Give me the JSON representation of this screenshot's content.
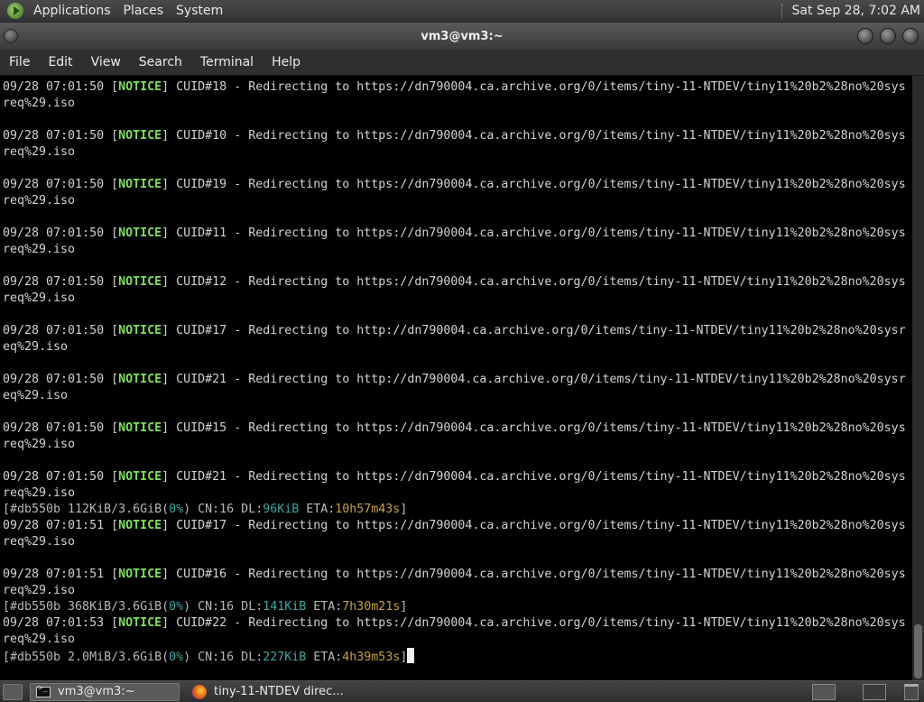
{
  "top_panel": {
    "menus": [
      "Applications",
      "Places",
      "System"
    ],
    "clock": "Sat Sep 28, 7:02 AM"
  },
  "window": {
    "title": "vm3@vm3:~"
  },
  "menubar": [
    "File",
    "Edit",
    "View",
    "Search",
    "Terminal",
    "Help"
  ],
  "terminal": {
    "lines": [
      [
        {
          "t": "09/28 07:01:50 [",
          "c": ""
        },
        {
          "t": "NOTICE",
          "c": "notice"
        },
        {
          "t": "] CUID#18 - Redirecting to https://dn790004.ca.archive.org/0/items/tiny-11-NTDEV/tiny11%20b2%28no%20sys",
          "c": ""
        }
      ],
      [
        {
          "t": "req%29.iso",
          "c": ""
        }
      ],
      [],
      [
        {
          "t": "09/28 07:01:50 [",
          "c": ""
        },
        {
          "t": "NOTICE",
          "c": "notice"
        },
        {
          "t": "] CUID#10 - Redirecting to https://dn790004.ca.archive.org/0/items/tiny-11-NTDEV/tiny11%20b2%28no%20sys",
          "c": ""
        }
      ],
      [
        {
          "t": "req%29.iso",
          "c": ""
        }
      ],
      [],
      [
        {
          "t": "09/28 07:01:50 [",
          "c": ""
        },
        {
          "t": "NOTICE",
          "c": "notice"
        },
        {
          "t": "] CUID#19 - Redirecting to https://dn790004.ca.archive.org/0/items/tiny-11-NTDEV/tiny11%20b2%28no%20sys",
          "c": ""
        }
      ],
      [
        {
          "t": "req%29.iso",
          "c": ""
        }
      ],
      [],
      [
        {
          "t": "09/28 07:01:50 [",
          "c": ""
        },
        {
          "t": "NOTICE",
          "c": "notice"
        },
        {
          "t": "] CUID#11 - Redirecting to https://dn790004.ca.archive.org/0/items/tiny-11-NTDEV/tiny11%20b2%28no%20sys",
          "c": ""
        }
      ],
      [
        {
          "t": "req%29.iso",
          "c": ""
        }
      ],
      [],
      [
        {
          "t": "09/28 07:01:50 [",
          "c": ""
        },
        {
          "t": "NOTICE",
          "c": "notice"
        },
        {
          "t": "] CUID#12 - Redirecting to https://dn790004.ca.archive.org/0/items/tiny-11-NTDEV/tiny11%20b2%28no%20sys",
          "c": ""
        }
      ],
      [
        {
          "t": "req%29.iso",
          "c": ""
        }
      ],
      [],
      [
        {
          "t": "09/28 07:01:50 [",
          "c": ""
        },
        {
          "t": "NOTICE",
          "c": "notice"
        },
        {
          "t": "] CUID#17 - Redirecting to http://dn790004.ca.archive.org/0/items/tiny-11-NTDEV/tiny11%20b2%28no%20sysr",
          "c": ""
        }
      ],
      [
        {
          "t": "eq%29.iso",
          "c": ""
        }
      ],
      [],
      [
        {
          "t": "09/28 07:01:50 [",
          "c": ""
        },
        {
          "t": "NOTICE",
          "c": "notice"
        },
        {
          "t": "] CUID#21 - Redirecting to http://dn790004.ca.archive.org/0/items/tiny-11-NTDEV/tiny11%20b2%28no%20sysr",
          "c": ""
        }
      ],
      [
        {
          "t": "eq%29.iso",
          "c": ""
        }
      ],
      [],
      [
        {
          "t": "09/28 07:01:50 [",
          "c": ""
        },
        {
          "t": "NOTICE",
          "c": "notice"
        },
        {
          "t": "] CUID#15 - Redirecting to https://dn790004.ca.archive.org/0/items/tiny-11-NTDEV/tiny11%20b2%28no%20sys",
          "c": ""
        }
      ],
      [
        {
          "t": "req%29.iso",
          "c": ""
        }
      ],
      [],
      [
        {
          "t": "09/28 07:01:50 [",
          "c": ""
        },
        {
          "t": "NOTICE",
          "c": "notice"
        },
        {
          "t": "] CUID#21 - Redirecting to https://dn790004.ca.archive.org/0/items/tiny-11-NTDEV/tiny11%20b2%28no%20sys",
          "c": ""
        }
      ],
      [
        {
          "t": "req%29.iso",
          "c": ""
        }
      ],
      [
        {
          "t": "[#db550b 112KiB/3.6GiB(",
          "c": "dim"
        },
        {
          "t": "0%",
          "c": "pct"
        },
        {
          "t": ") CN:16 DL:",
          "c": "dim"
        },
        {
          "t": "96KiB",
          "c": "dl"
        },
        {
          "t": " ETA:",
          "c": "dim"
        },
        {
          "t": "10h57m43s",
          "c": "eta"
        },
        {
          "t": "]",
          "c": "dim"
        }
      ],
      [
        {
          "t": "09/28 07:01:51 [",
          "c": ""
        },
        {
          "t": "NOTICE",
          "c": "notice"
        },
        {
          "t": "] CUID#17 - Redirecting to https://dn790004.ca.archive.org/0/items/tiny-11-NTDEV/tiny11%20b2%28no%20sys",
          "c": ""
        }
      ],
      [
        {
          "t": "req%29.iso",
          "c": ""
        }
      ],
      [],
      [
        {
          "t": "09/28 07:01:51 [",
          "c": ""
        },
        {
          "t": "NOTICE",
          "c": "notice"
        },
        {
          "t": "] CUID#16 - Redirecting to https://dn790004.ca.archive.org/0/items/tiny-11-NTDEV/tiny11%20b2%28no%20sys",
          "c": ""
        }
      ],
      [
        {
          "t": "req%29.iso",
          "c": ""
        }
      ],
      [
        {
          "t": "[#db550b 368KiB/3.6GiB(",
          "c": "dim"
        },
        {
          "t": "0%",
          "c": "pct"
        },
        {
          "t": ") CN:16 DL:",
          "c": "dim"
        },
        {
          "t": "141KiB",
          "c": "dl"
        },
        {
          "t": " ETA:",
          "c": "dim"
        },
        {
          "t": "7h30m21s",
          "c": "eta"
        },
        {
          "t": "]",
          "c": "dim"
        }
      ],
      [
        {
          "t": "09/28 07:01:53 [",
          "c": ""
        },
        {
          "t": "NOTICE",
          "c": "notice"
        },
        {
          "t": "] CUID#22 - Redirecting to https://dn790004.ca.archive.org/0/items/tiny-11-NTDEV/tiny11%20b2%28no%20sys",
          "c": ""
        }
      ],
      [
        {
          "t": "req%29.iso",
          "c": ""
        }
      ],
      [
        {
          "t": "[#db550b 2.0MiB/3.6GiB(",
          "c": "dim"
        },
        {
          "t": "0%",
          "c": "pct"
        },
        {
          "t": ") CN:16 DL:",
          "c": "dim"
        },
        {
          "t": "227KiB",
          "c": "dl"
        },
        {
          "t": " ETA:",
          "c": "dim"
        },
        {
          "t": "4h39m53s",
          "c": "eta"
        },
        {
          "t": "]",
          "c": "dim"
        }
      ]
    ]
  },
  "taskbar": {
    "tasks": [
      {
        "label": "vm3@vm3:~",
        "icon": "terminal-icon",
        "active": true
      },
      {
        "label": "tiny-11-NTDEV direc...",
        "icon": "firefox-icon",
        "active": false
      }
    ]
  },
  "colors": {
    "notice": "#7ee05a",
    "progress_value": "#3aa6a0",
    "eta": "#c7a23a",
    "terminal_bg": "#000000"
  }
}
